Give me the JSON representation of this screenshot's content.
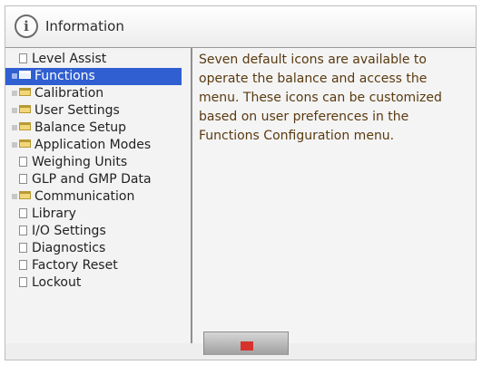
{
  "header": {
    "info_icon_glyph": "i",
    "title": "Information"
  },
  "sidebar": {
    "items": [
      {
        "label": "Level Assist",
        "icon": "doc-icon",
        "expandable": false
      },
      {
        "label": "Functions",
        "icon": "folder-icon",
        "expandable": true,
        "selected": true
      },
      {
        "label": "Calibration",
        "icon": "folder-icon",
        "expandable": true
      },
      {
        "label": "User Settings",
        "icon": "folder-icon",
        "expandable": true
      },
      {
        "label": "Balance Setup",
        "icon": "folder-icon",
        "expandable": true
      },
      {
        "label": "Application Modes",
        "icon": "folder-icon",
        "expandable": true
      },
      {
        "label": "Weighing Units",
        "icon": "doc-icon",
        "expandable": false
      },
      {
        "label": "GLP and GMP Data",
        "icon": "doc-icon",
        "expandable": false
      },
      {
        "label": "Communication",
        "icon": "folder-icon",
        "expandable": true
      },
      {
        "label": "Library",
        "icon": "doc-icon",
        "expandable": false
      },
      {
        "label": "I/O Settings",
        "icon": "doc-icon",
        "expandable": false
      },
      {
        "label": "Diagnostics",
        "icon": "doc-icon",
        "expandable": false
      },
      {
        "label": "Factory Reset",
        "icon": "doc-icon",
        "expandable": false
      },
      {
        "label": "Lockout",
        "icon": "doc-icon",
        "expandable": false
      }
    ]
  },
  "main": {
    "description": "Seven default icons are available to operate the balance and access the menu. These icons can be customized based on user preferences in the Functions Configuration menu."
  },
  "footer": {
    "back_icon": "back-icon"
  },
  "colors": {
    "selection": "#2f5fd0",
    "text": "#222222",
    "back_icon": "#d7322b"
  }
}
